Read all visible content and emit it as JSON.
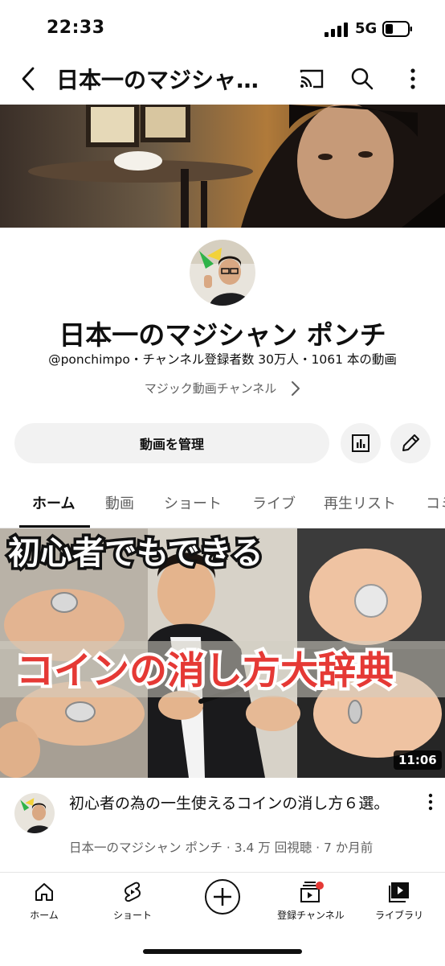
{
  "status_bar": {
    "time": "22:33",
    "network": "5G"
  },
  "header": {
    "title": "日本一のマジシャ…"
  },
  "channel": {
    "name": "日本一のマジシャン ポンチ",
    "handle": "@ponchimpo",
    "subscribers": "チャンネル登録者数 30万人",
    "video_count": "1061 本の動画",
    "separator": "・",
    "description": "マジック動画チャンネル"
  },
  "actions": {
    "manage_label": "動画を管理"
  },
  "tabs": [
    {
      "label": "ホーム",
      "active": true
    },
    {
      "label": "動画",
      "active": false
    },
    {
      "label": "ショート",
      "active": false
    },
    {
      "label": "ライブ",
      "active": false
    },
    {
      "label": "再生リスト",
      "active": false
    },
    {
      "label": "コミ",
      "active": false
    }
  ],
  "video": {
    "thumbnail_text_top": "初心者でもできる",
    "thumbnail_text_main": "コインの消し方大辞典",
    "duration": "11:06",
    "title": "初心者の為の一生使えるコインの消し方６選。",
    "meta": "日本一のマジシャン ポンチ · 3.4 万 回視聴 · 7 か月前"
  },
  "bottom_nav": [
    {
      "label": "ホーム",
      "icon": "home-icon"
    },
    {
      "label": "ショート",
      "icon": "shorts-icon"
    },
    {
      "label": "",
      "icon": "create-icon"
    },
    {
      "label": "登録チャンネル",
      "icon": "subscriptions-icon"
    },
    {
      "label": "ライブラリ",
      "icon": "library-icon"
    }
  ],
  "colors": {
    "accent_red": "#e53935",
    "text": "#0f0f0f",
    "muted": "#606060",
    "button_bg": "#f2f2f2"
  }
}
